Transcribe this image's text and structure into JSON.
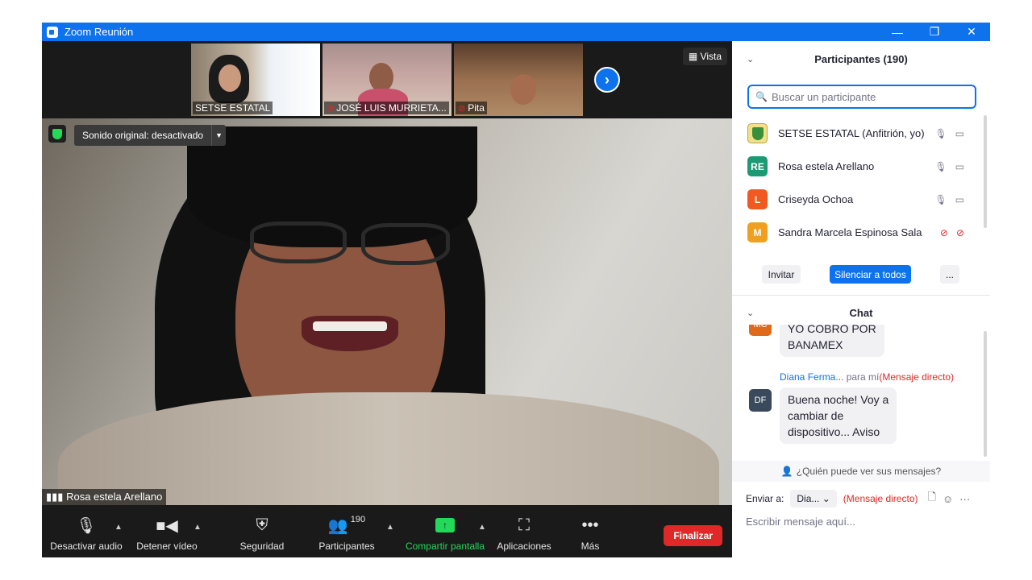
{
  "window": {
    "title": "Zoom Reunión",
    "controls": [
      "—",
      "❐",
      "✕"
    ]
  },
  "strip": {
    "thumbs": [
      {
        "name": "SETSE ESTATAL",
        "muted": false
      },
      {
        "name": "JOSÉ LUIS MURRIETA...",
        "muted": true
      },
      {
        "name": "Pita",
        "muted": true
      }
    ],
    "view_label": "Vista"
  },
  "main_video": {
    "sound_label": "Sonido original: desactivado",
    "speaker_name": "Rosa estela Arellano"
  },
  "toolbar": {
    "audio_label": "Desactivar audio",
    "video_label": "Detener vídeo",
    "security_label": "Seguridad",
    "participants_label": "Participantes",
    "participants_count": "190",
    "share_label": "Compartir pantalla",
    "apps_label": "Aplicaciones",
    "more_label": "Más",
    "end_label": "Finalizar"
  },
  "participants": {
    "header": "Participantes (190)",
    "search_placeholder": "Buscar un participante",
    "items": [
      {
        "initials": "",
        "name": "SETSE ESTATAL (Anfitrión, yo)",
        "color": "#f2e08a"
      },
      {
        "initials": "RE",
        "name": "Rosa estela Arellano",
        "color": "#1d9a73"
      },
      {
        "initials": "L",
        "name": "Criseyda Ochoa",
        "color": "#f05a21"
      },
      {
        "initials": "M",
        "name": "Sandra Marcela Espinosa Sala",
        "color": "#f0a020"
      }
    ],
    "invite_label": "Invitar",
    "mute_all_label": "Silenciar a todos",
    "more_label": "..."
  },
  "chat": {
    "header": "Chat",
    "messages": [
      {
        "avatar": "MC",
        "text_lines": [
          "YO COBRO POR",
          "BANAMEX"
        ]
      },
      {
        "avatar": "DF",
        "sender": "Diana Ferma...",
        "to": "para mí",
        "dm": "(Mensaje directo)",
        "text_lines": [
          "Buena noche! Voy a",
          "cambiar de",
          "dispositivo... Aviso"
        ]
      }
    ],
    "who_can_see": "¿Quién puede ver sus mensajes?",
    "send_to_label": "Enviar a:",
    "send_to_value": "Dia...",
    "send_to_dm": "(Mensaje directo)",
    "input_placeholder": "Escribir mensaje aquí..."
  },
  "colors": {
    "zoom_blue": "#0e72ed",
    "end_red": "#e02828",
    "share_green": "#23d959"
  }
}
